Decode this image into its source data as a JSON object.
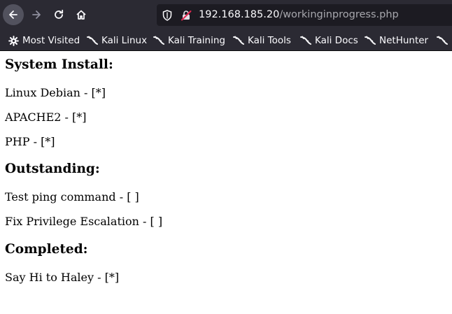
{
  "browser": {
    "url": {
      "host": "192.168.185.20",
      "path": "/workinginprogress.php"
    },
    "bookmarks": [
      {
        "label": "Most Visited",
        "icon": "gear-icon"
      },
      {
        "label": "Kali Linux",
        "icon": "kali-dragon-icon"
      },
      {
        "label": "Kali Training",
        "icon": "kali-dragon-icon"
      },
      {
        "label": "Kali Tools",
        "icon": "kali-dragon-icon"
      },
      {
        "label": "Kali Docs",
        "icon": "kali-dragon-icon"
      },
      {
        "label": "NetHunter",
        "icon": "kali-dragon-icon"
      }
    ],
    "colors": {
      "toolbar": "#2b2a33",
      "urlbar": "#1c1b22",
      "text": "#fbfbfe"
    }
  },
  "page": {
    "sections": [
      {
        "heading": "System Install:",
        "items": [
          "Linux Debian - [*]",
          "APACHE2 - [*]",
          "PHP - [*]"
        ]
      },
      {
        "heading": "Outstanding:",
        "items": [
          "Test ping command - [ ]",
          "Fix Privilege Escalation - [ ]"
        ]
      },
      {
        "heading": "Completed:",
        "items": [
          "Say Hi to Haley - [*]"
        ]
      }
    ]
  }
}
